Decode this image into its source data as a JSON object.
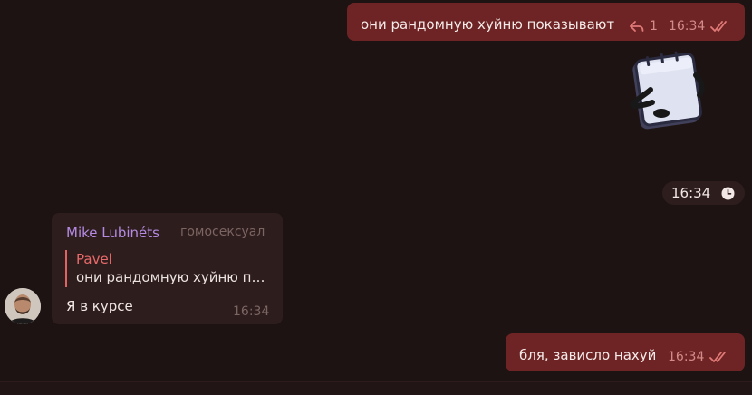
{
  "messages": {
    "out1": {
      "text": "они рандомную хуйню показывают",
      "reply_count": "1",
      "time": "16:34"
    },
    "sticker": {
      "time": "16:34"
    },
    "in1": {
      "sender": "Mike Lubinéts",
      "sender_title": "гомосексуал",
      "quote_author": "Pavel",
      "quote_text": "они рандомную хуйню показывают",
      "text": "Я в курсе",
      "time": "16:34"
    },
    "out2": {
      "text": "бля, зависло нахуй",
      "time": "16:34"
    }
  },
  "colors": {
    "background": "#1e1313",
    "outgoing_bubble": "#6e2424",
    "incoming_bubble": "#2d1d1c",
    "sender_name": "#b48ae2",
    "quote_accent": "#e86a6a"
  },
  "icons": {
    "reply": "reply-arrow-icon",
    "read": "double-check-icon",
    "pending": "clock-icon",
    "sticker": "notepad-sticker"
  }
}
